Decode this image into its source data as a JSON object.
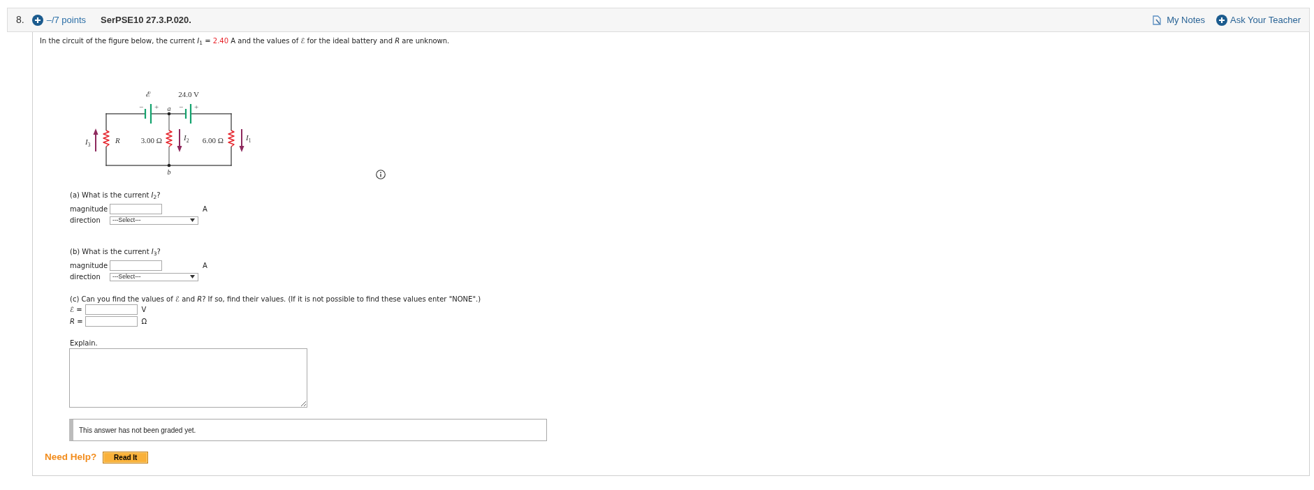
{
  "question": {
    "number": "8.",
    "points": "–/7 points",
    "code": "SerPSE10 27.3.P.020."
  },
  "header_links": [
    {
      "kind": "notes",
      "label": "My Notes"
    },
    {
      "kind": "ask",
      "label": "Ask Your Teacher"
    }
  ],
  "prompt": [
    {
      "kind": "plain",
      "text": "In the circuit of the figure below, the current *I*$_{1}$ ="
    },
    {
      "kind": "given",
      "text": "2.40"
    },
    {
      "kind": "plain",
      "text": "A and the values of ℰ for the ideal battery and *R* are unknown."
    }
  ],
  "figure": {
    "batteries": [
      {
        "label": "ℰ",
        "minus": "−",
        "plus": "+"
      },
      {
        "label": "24.0 V",
        "minus": "−",
        "plus": "+"
      }
    ],
    "nodes": [
      "a",
      "b"
    ],
    "resistors": [
      "R",
      "3.00 Ω",
      "6.00 Ω"
    ],
    "currents": [
      {
        "kind": "up",
        "symbol": "I",
        "sub": "3"
      },
      {
        "kind": "down",
        "symbol": "I",
        "sub": "2"
      },
      {
        "kind": "down",
        "symbol": "I",
        "sub": "1"
      }
    ]
  },
  "parts": [
    {
      "prompt": "(a) What is the current *I*$_{2}$?",
      "fields": [
        {
          "kind": "input",
          "label": "magnitude",
          "unit": "A"
        },
        {
          "kind": "select",
          "label": "direction",
          "value": "---Select---"
        }
      ]
    },
    {
      "prompt": "(b) What is the current *I*$_{3}$?",
      "fields": [
        {
          "kind": "input",
          "label": "magnitude",
          "unit": "A"
        },
        {
          "kind": "select",
          "label": "direction",
          "value": "---Select---"
        }
      ]
    },
    {
      "prompt": "(c) Can you find the values of ℰ and *R*? If so, find their values. (If it is not possible to find these values enter \"NONE\".)",
      "fields": [
        {
          "kind": "input",
          "label": "ℰ =",
          "unit": "V"
        },
        {
          "kind": "input",
          "label": "*R* =",
          "unit": "Ω"
        }
      ]
    }
  ],
  "explain": {
    "label": "Explain."
  },
  "grading_notice": "This answer has not been graded yet.",
  "help": {
    "label": "Need Help?",
    "buttons": [
      "Read It"
    ]
  }
}
